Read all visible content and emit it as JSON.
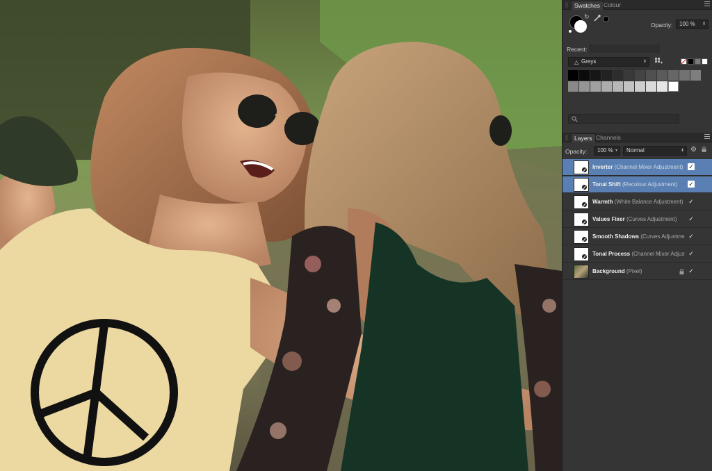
{
  "swatches_panel": {
    "tabs": [
      "Swatches",
      "Colour"
    ],
    "opacity_label": "Opacity:",
    "opacity_value": "100 %",
    "recent_label": "Recent:",
    "palette_name": "Greys",
    "grey_row_1": [
      "#000000",
      "#0b0b0b",
      "#161616",
      "#222222",
      "#2d2d2d",
      "#393939",
      "#444444",
      "#505050",
      "#5b5b5b",
      "#676767",
      "#727272",
      "#7e7e7e"
    ],
    "grey_row_2": [
      "#898989",
      "#959595",
      "#a0a0a0",
      "#acacac",
      "#b7b7b7",
      "#c3c3c3",
      "#cecece",
      "#dadada",
      "#e5e5e5",
      "#ffffff"
    ],
    "search_placeholder": ""
  },
  "layers_panel": {
    "tabs": [
      "Layers",
      "Channels"
    ],
    "opacity_label": "Opacity:",
    "opacity_value": "100 %",
    "blend_mode": "Normal",
    "layers": [
      {
        "name": "Inverter",
        "type": "(Channel Mixer Adjustment)",
        "selected": true
      },
      {
        "name": "Tonal Shift",
        "type": "(Recolour Adjustment)",
        "selected": true
      },
      {
        "name": "Warmth",
        "type": "(White Balance Adjustment)",
        "selected": false
      },
      {
        "name": "Values Fixer",
        "type": "(Curves Adjustment)",
        "selected": false
      },
      {
        "name": "Smooth Shadows",
        "type": "(Curves Adjustment)",
        "selected": false
      },
      {
        "name": "Tonal Process",
        "type": "(Channel Mixer Adjustment)",
        "selected": false
      },
      {
        "name": "Background",
        "type": "(Pixel)",
        "selected": false,
        "locked": true
      }
    ]
  },
  "icons": {
    "swap": "swap-colors-icon",
    "picker": "color-picker-icon",
    "add_swatch": "add-swatch-icon",
    "search": "search-icon",
    "gear": "gear-icon",
    "lock": "lock-icon",
    "checkmark": "visibility-check-icon",
    "menu": "panel-menu-icon"
  },
  "colors": {
    "selection_blue": "#5a80b3",
    "panel_bg": "#353535"
  }
}
